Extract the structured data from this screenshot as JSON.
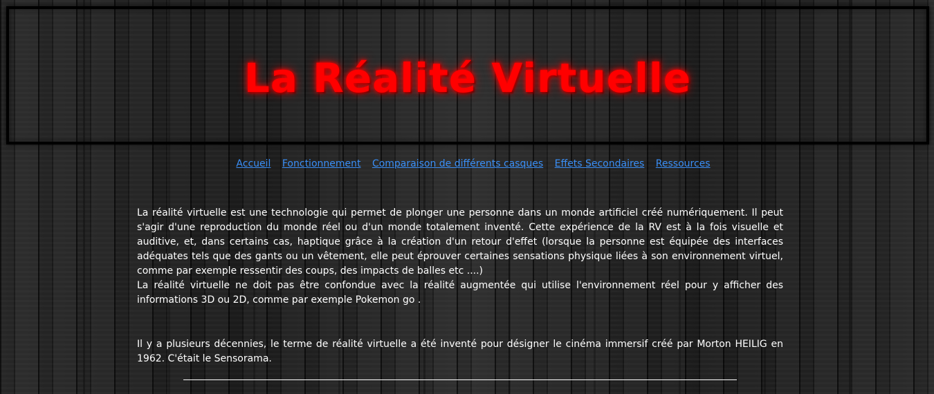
{
  "header": {
    "title": "La Réalité Virtuelle"
  },
  "nav": {
    "items": [
      {
        "label": "Accueil"
      },
      {
        "label": "Fonctionnement"
      },
      {
        "label": "Comparaison de différents casques"
      },
      {
        "label": "Effets Secondaires"
      },
      {
        "label": "Ressources"
      }
    ]
  },
  "content": {
    "paragraph_1": "La réalité virtuelle est une technologie qui permet de plonger une personne dans un monde artificiel créé numériquement. Il peut s'agir d'une reproduction du monde réel ou d'un monde totalement inventé. Cette expérience de la RV est à la fois visuelle et auditive, et, dans certains cas, haptique grâce à la création d'un retour d'effet (lorsque la personne est équipée des interfaces adéquates tels que des gants ou un vêtement, elle peut éprouver certaines sensations physique liées à son environnement virtuel, comme par exemple ressentir des coups, des impacts de balles etc ....)",
    "paragraph_2": "La réalité virtuelle ne doit pas être confondue avec la réalité augmentée qui utilise l'environnement réel pour y afficher des informations 3D ou 2D, comme par exemple Pokemon go .",
    "paragraph_3": "Il y a plusieurs décennies, le terme de réalité virtuelle a été inventé pour désigner le cinéma immersif créé par Morton HEILIG en 1962. C'était le Sensorama."
  },
  "colors": {
    "title": "#ff0000",
    "link": "#3a8ff7",
    "text": "#ffffff",
    "background": "#1b1b1b"
  }
}
